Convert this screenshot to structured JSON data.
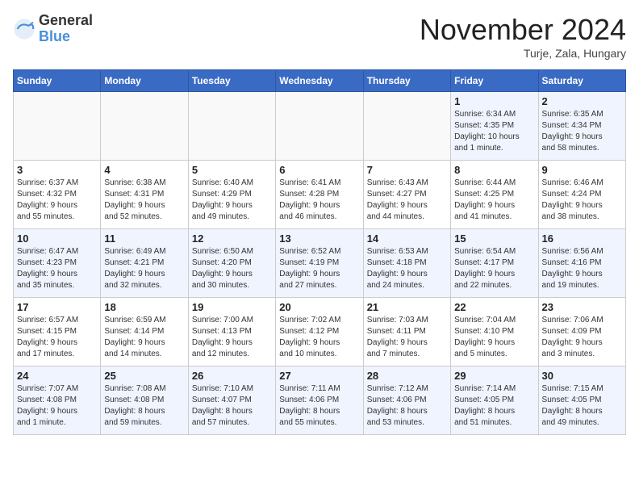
{
  "logo": {
    "general": "General",
    "blue": "Blue"
  },
  "title": "November 2024",
  "location": "Turje, Zala, Hungary",
  "days_of_week": [
    "Sunday",
    "Monday",
    "Tuesday",
    "Wednesday",
    "Thursday",
    "Friday",
    "Saturday"
  ],
  "weeks": [
    [
      {
        "day": "",
        "info": ""
      },
      {
        "day": "",
        "info": ""
      },
      {
        "day": "",
        "info": ""
      },
      {
        "day": "",
        "info": ""
      },
      {
        "day": "",
        "info": ""
      },
      {
        "day": "1",
        "info": "Sunrise: 6:34 AM\nSunset: 4:35 PM\nDaylight: 10 hours\nand 1 minute."
      },
      {
        "day": "2",
        "info": "Sunrise: 6:35 AM\nSunset: 4:34 PM\nDaylight: 9 hours\nand 58 minutes."
      }
    ],
    [
      {
        "day": "3",
        "info": "Sunrise: 6:37 AM\nSunset: 4:32 PM\nDaylight: 9 hours\nand 55 minutes."
      },
      {
        "day": "4",
        "info": "Sunrise: 6:38 AM\nSunset: 4:31 PM\nDaylight: 9 hours\nand 52 minutes."
      },
      {
        "day": "5",
        "info": "Sunrise: 6:40 AM\nSunset: 4:29 PM\nDaylight: 9 hours\nand 49 minutes."
      },
      {
        "day": "6",
        "info": "Sunrise: 6:41 AM\nSunset: 4:28 PM\nDaylight: 9 hours\nand 46 minutes."
      },
      {
        "day": "7",
        "info": "Sunrise: 6:43 AM\nSunset: 4:27 PM\nDaylight: 9 hours\nand 44 minutes."
      },
      {
        "day": "8",
        "info": "Sunrise: 6:44 AM\nSunset: 4:25 PM\nDaylight: 9 hours\nand 41 minutes."
      },
      {
        "day": "9",
        "info": "Sunrise: 6:46 AM\nSunset: 4:24 PM\nDaylight: 9 hours\nand 38 minutes."
      }
    ],
    [
      {
        "day": "10",
        "info": "Sunrise: 6:47 AM\nSunset: 4:23 PM\nDaylight: 9 hours\nand 35 minutes."
      },
      {
        "day": "11",
        "info": "Sunrise: 6:49 AM\nSunset: 4:21 PM\nDaylight: 9 hours\nand 32 minutes."
      },
      {
        "day": "12",
        "info": "Sunrise: 6:50 AM\nSunset: 4:20 PM\nDaylight: 9 hours\nand 30 minutes."
      },
      {
        "day": "13",
        "info": "Sunrise: 6:52 AM\nSunset: 4:19 PM\nDaylight: 9 hours\nand 27 minutes."
      },
      {
        "day": "14",
        "info": "Sunrise: 6:53 AM\nSunset: 4:18 PM\nDaylight: 9 hours\nand 24 minutes."
      },
      {
        "day": "15",
        "info": "Sunrise: 6:54 AM\nSunset: 4:17 PM\nDaylight: 9 hours\nand 22 minutes."
      },
      {
        "day": "16",
        "info": "Sunrise: 6:56 AM\nSunset: 4:16 PM\nDaylight: 9 hours\nand 19 minutes."
      }
    ],
    [
      {
        "day": "17",
        "info": "Sunrise: 6:57 AM\nSunset: 4:15 PM\nDaylight: 9 hours\nand 17 minutes."
      },
      {
        "day": "18",
        "info": "Sunrise: 6:59 AM\nSunset: 4:14 PM\nDaylight: 9 hours\nand 14 minutes."
      },
      {
        "day": "19",
        "info": "Sunrise: 7:00 AM\nSunset: 4:13 PM\nDaylight: 9 hours\nand 12 minutes."
      },
      {
        "day": "20",
        "info": "Sunrise: 7:02 AM\nSunset: 4:12 PM\nDaylight: 9 hours\nand 10 minutes."
      },
      {
        "day": "21",
        "info": "Sunrise: 7:03 AM\nSunset: 4:11 PM\nDaylight: 9 hours\nand 7 minutes."
      },
      {
        "day": "22",
        "info": "Sunrise: 7:04 AM\nSunset: 4:10 PM\nDaylight: 9 hours\nand 5 minutes."
      },
      {
        "day": "23",
        "info": "Sunrise: 7:06 AM\nSunset: 4:09 PM\nDaylight: 9 hours\nand 3 minutes."
      }
    ],
    [
      {
        "day": "24",
        "info": "Sunrise: 7:07 AM\nSunset: 4:08 PM\nDaylight: 9 hours\nand 1 minute."
      },
      {
        "day": "25",
        "info": "Sunrise: 7:08 AM\nSunset: 4:08 PM\nDaylight: 8 hours\nand 59 minutes."
      },
      {
        "day": "26",
        "info": "Sunrise: 7:10 AM\nSunset: 4:07 PM\nDaylight: 8 hours\nand 57 minutes."
      },
      {
        "day": "27",
        "info": "Sunrise: 7:11 AM\nSunset: 4:06 PM\nDaylight: 8 hours\nand 55 minutes."
      },
      {
        "day": "28",
        "info": "Sunrise: 7:12 AM\nSunset: 4:06 PM\nDaylight: 8 hours\nand 53 minutes."
      },
      {
        "day": "29",
        "info": "Sunrise: 7:14 AM\nSunset: 4:05 PM\nDaylight: 8 hours\nand 51 minutes."
      },
      {
        "day": "30",
        "info": "Sunrise: 7:15 AM\nSunset: 4:05 PM\nDaylight: 8 hours\nand 49 minutes."
      }
    ]
  ]
}
